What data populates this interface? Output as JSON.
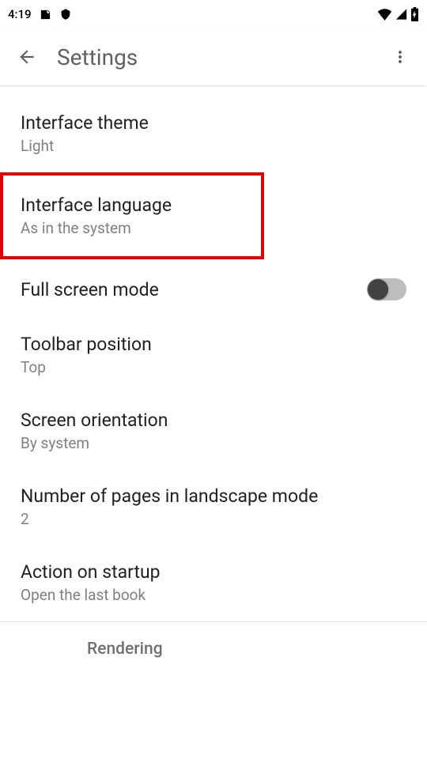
{
  "status_bar": {
    "time": "4:19"
  },
  "app_bar": {
    "title": "Settings"
  },
  "settings": {
    "interface_theme": {
      "title": "Interface theme",
      "value": "Light"
    },
    "interface_language": {
      "title": "Interface language",
      "value": "As in the system"
    },
    "full_screen_mode": {
      "title": "Full screen mode"
    },
    "toolbar_position": {
      "title": "Toolbar position",
      "value": "Top"
    },
    "screen_orientation": {
      "title": "Screen orientation",
      "value": "By system"
    },
    "landscape_pages": {
      "title": "Number of pages in landscape mode",
      "value": "2"
    },
    "startup_action": {
      "title": "Action on startup",
      "value": "Open the last book"
    }
  },
  "sections": {
    "rendering": "Rendering"
  }
}
